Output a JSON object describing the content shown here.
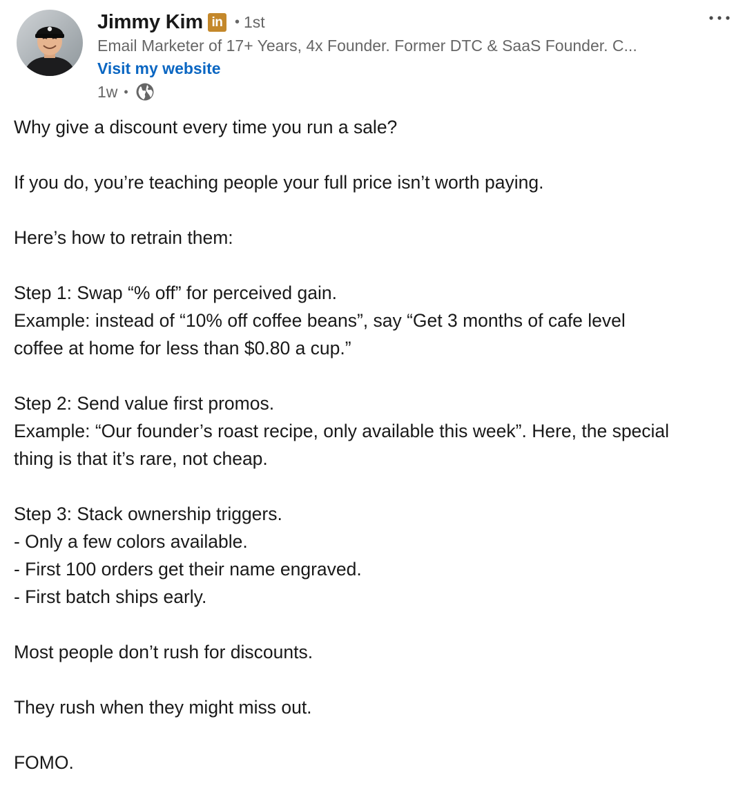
{
  "author": {
    "name": "Jimmy Kim",
    "badge": "in",
    "degree": "1st",
    "separator": "•",
    "headline": "Email Marketer of 17+ Years, 4x Founder. Former DTC & SaaS Founder. C...",
    "website_label": "Visit my website",
    "timestamp": "1w",
    "meta_separator": "•",
    "visibility_icon": "globe-icon",
    "badge_color": "#c4882b",
    "link_color": "#0a66c2"
  },
  "post": {
    "more_icon": "more-options-icon",
    "paragraphs": [
      {
        "lines": [
          "Why give a discount every time you run a sale?"
        ]
      },
      {
        "lines": [
          "If you do, you’re teaching people your full price isn’t worth paying."
        ]
      },
      {
        "lines": [
          "Here’s how to retrain them:"
        ]
      },
      {
        "lines": [
          "Step 1: Swap “% off” for perceived gain.",
          "Example: instead of “10% off coffee beans”, say “Get 3 months of cafe level",
          "coffee at home for less than $0.80 a cup.”"
        ]
      },
      {
        "lines": [
          "Step 2: Send value first promos.",
          "Example: “Our founder’s roast recipe, only available this week”. Here, the special",
          "thing is that it’s rare, not cheap."
        ]
      },
      {
        "lines": [
          "Step 3: Stack ownership triggers.",
          "- Only a few colors available.",
          "- First 100 orders get their name engraved.",
          "- First batch ships early."
        ]
      },
      {
        "lines": [
          "Most people don’t rush for discounts."
        ]
      },
      {
        "lines": [
          "They rush when they might miss out."
        ]
      },
      {
        "lines": [
          "FOMO."
        ]
      }
    ]
  }
}
